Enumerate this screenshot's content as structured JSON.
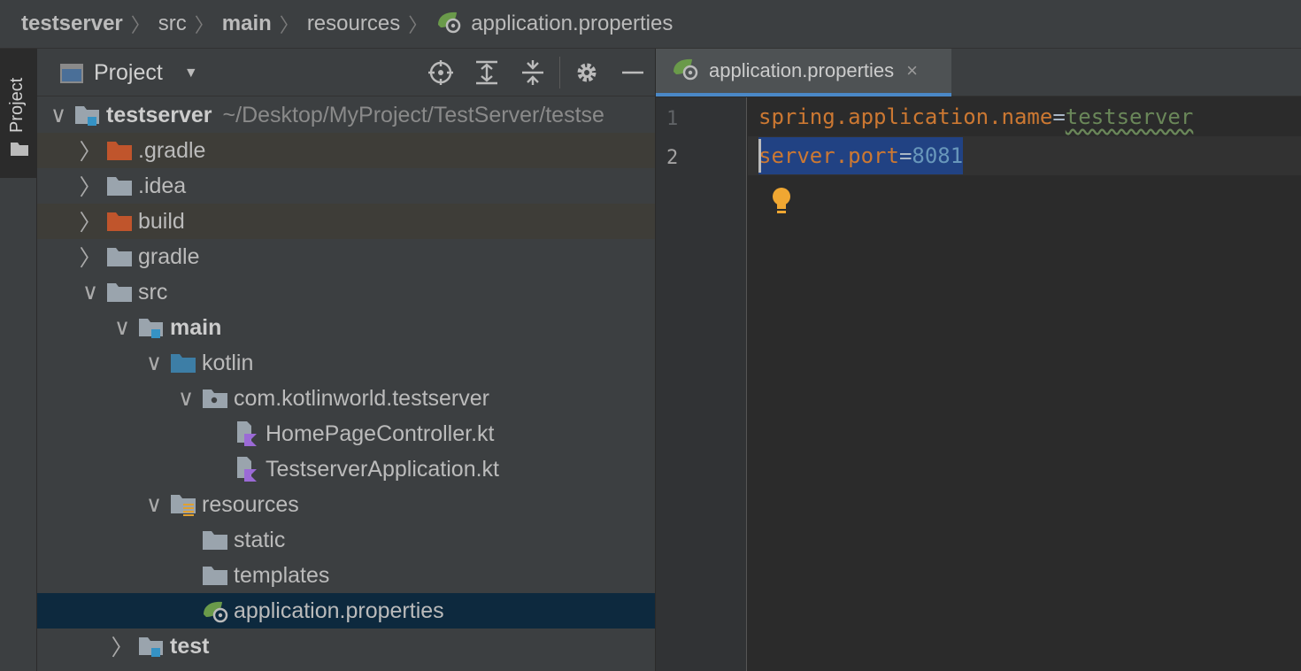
{
  "breadcrumb": {
    "items": [
      "testserver",
      "src",
      "main",
      "resources",
      "application.properties"
    ]
  },
  "side_strip": {
    "tab_label": "Project"
  },
  "project_panel": {
    "title": "Project",
    "tools": [
      "locate-icon",
      "expand-all-icon",
      "collapse-all-icon",
      "gear-icon",
      "minimize-icon"
    ],
    "tree": [
      {
        "label": "testserver",
        "path": "~/Desktop/MyProject/TestServer/testse",
        "icon": "module-folder-icon",
        "expanded": true
      },
      {
        "label": ".gradle",
        "icon": "excluded-folder-icon",
        "expanded": false
      },
      {
        "label": ".idea",
        "icon": "folder-icon",
        "expanded": false
      },
      {
        "label": "build",
        "icon": "excluded-folder-icon",
        "expanded": false
      },
      {
        "label": "gradle",
        "icon": "folder-icon",
        "expanded": false
      },
      {
        "label": "src",
        "icon": "folder-icon",
        "expanded": true
      },
      {
        "label": "main",
        "icon": "source-set-folder-icon",
        "expanded": true
      },
      {
        "label": "kotlin",
        "icon": "source-root-folder-icon",
        "expanded": true
      },
      {
        "label": "com.kotlinworld.testserver",
        "icon": "package-icon",
        "expanded": true
      },
      {
        "label": "HomePageController.kt",
        "icon": "kotlin-file-icon"
      },
      {
        "label": "TestserverApplication.kt",
        "icon": "kotlin-file-icon"
      },
      {
        "label": "resources",
        "icon": "resources-folder-icon",
        "expanded": true
      },
      {
        "label": "static",
        "icon": "folder-icon"
      },
      {
        "label": "templates",
        "icon": "folder-icon"
      },
      {
        "label": "application.properties",
        "icon": "spring-properties-icon"
      },
      {
        "label": "test",
        "icon": "source-set-folder-icon",
        "expanded": false
      }
    ]
  },
  "editor": {
    "tab": {
      "label": "application.properties",
      "close": "×"
    },
    "lines": [
      {
        "number": "1",
        "key": "spring.application.name",
        "eq": "=",
        "value": "testserver"
      },
      {
        "number": "2",
        "key": "server.port",
        "eq": "=",
        "value": "8081"
      }
    ]
  },
  "colors": {
    "keyword": "#cc7832",
    "string_value": "#6a8759",
    "number_value": "#6897bb",
    "selection": "#214283",
    "accent": "#4a88c7"
  }
}
